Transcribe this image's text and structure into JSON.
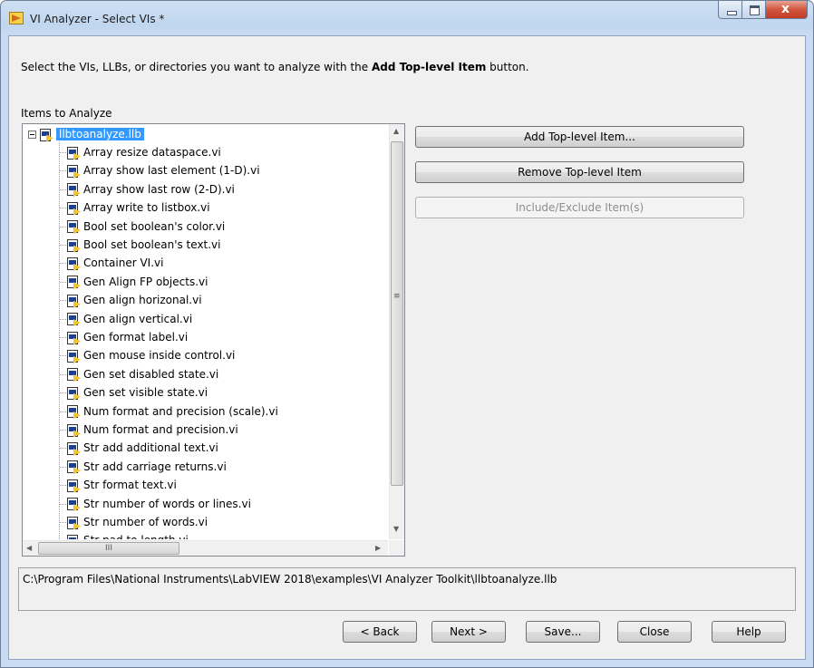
{
  "window": {
    "title": "VI Analyzer - Select VIs *",
    "close_glyph": "x"
  },
  "instruction": {
    "prefix": "Select the VIs, LLBs, or directories you want to analyze with the ",
    "bold": "Add Top-level Item",
    "suffix": " button."
  },
  "items_label": "Items to Analyze",
  "tree": {
    "root": "llbtoanalyze.llb",
    "children": [
      "Array resize dataspace.vi",
      "Array show last element (1-D).vi",
      "Array show last row (2-D).vi",
      "Array write to listbox.vi",
      "Bool set boolean's color.vi",
      "Bool set boolean's text.vi",
      "Container VI.vi",
      "Gen Align FP objects.vi",
      "Gen align horizonal.vi",
      "Gen align vertical.vi",
      "Gen format label.vi",
      "Gen mouse inside control.vi",
      "Gen set disabled state.vi",
      "Gen set visible state.vi",
      "Num format and precision (scale).vi",
      "Num format and precision.vi",
      "Str add additional text.vi",
      "Str add carriage returns.vi",
      "Str format text.vi",
      "Str number of words or lines.vi",
      "Str number of words.vi",
      "Str pad to length.vi"
    ]
  },
  "scrollbars": {
    "up": "▲",
    "down": "▼",
    "left": "◀",
    "right": "▶",
    "vgrip": "≡",
    "hgrip": "III"
  },
  "side_buttons": {
    "add": "Add Top-level Item...",
    "remove": "Remove Top-level Item",
    "include": "Include/Exclude Item(s)"
  },
  "path": "C:\\Program Files\\National Instruments\\LabVIEW 2018\\examples\\VI Analyzer Toolkit\\llbtoanalyze.llb",
  "footer_buttons": {
    "back": "< Back",
    "next": "Next >",
    "save": "Save...",
    "close": "Close",
    "help": "Help"
  },
  "colors": {
    "selection": "#3399ff",
    "disabled_text": "#8d8d8d"
  }
}
